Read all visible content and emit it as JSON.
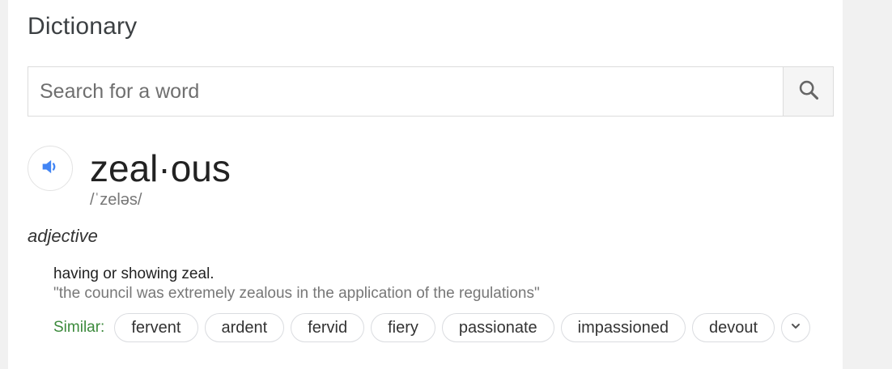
{
  "dictionary": {
    "title": "Dictionary",
    "search": {
      "placeholder": "Search for a word",
      "value": ""
    },
    "entry": {
      "headword": "zeal·ous",
      "phonetic": "/ˈzeləs/",
      "part_of_speech": "adjective",
      "definition": "having or showing zeal.",
      "example": "\"the council was extremely zealous in the application of the regulations\"",
      "similar_label": "Similar:",
      "similar": [
        "fervent",
        "ardent",
        "fervid",
        "fiery",
        "passionate",
        "impassioned",
        "devout"
      ]
    }
  },
  "icons": {
    "search": "search-icon",
    "audio": "speaker-icon",
    "expand": "chevron-down-icon"
  },
  "colors": {
    "accent_blue": "#4285f4",
    "similar_green": "#3c8a3c"
  }
}
